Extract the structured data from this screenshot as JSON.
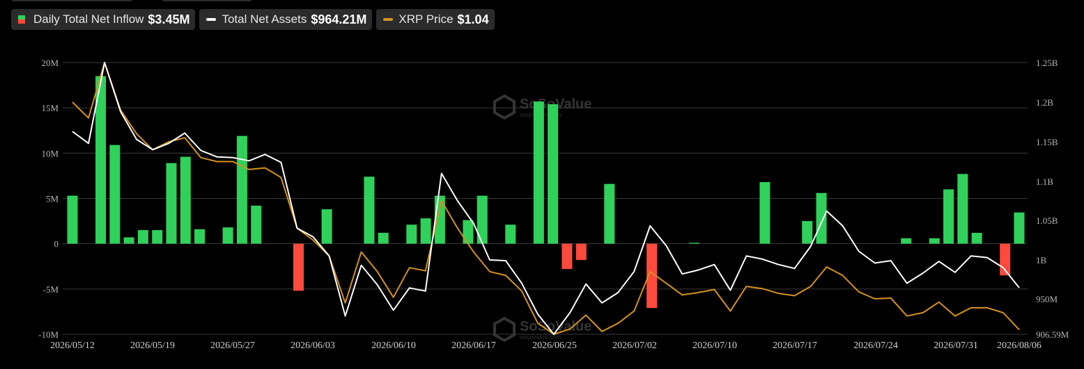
{
  "legend": [
    {
      "label": "Daily Total Net Inflow",
      "value": "$3.45M",
      "swatch": "split",
      "colors": [
        "#2fd15a",
        "#ff4a3d"
      ]
    },
    {
      "label": "Total Net Assets",
      "value": "$964.21M",
      "swatch": "line",
      "color": "#ffffff"
    },
    {
      "label": "XRP Price",
      "value": "$1.04",
      "swatch": "line",
      "color": "#d4921e"
    }
  ],
  "watermark": {
    "brand": "SoSoValue",
    "url": "sosovalue.com"
  },
  "chart_data": {
    "type": "bar",
    "x_ticks": [
      "2026/05/12",
      "2026/05/19",
      "2026/05/27",
      "2026/06/03",
      "2026/06/10",
      "2026/06/17",
      "2026/06/25",
      "2026/07/02",
      "2026/07/10",
      "2026/07/17",
      "2026/07/24",
      "2026/07/31",
      "2026/08/06"
    ],
    "y_left": {
      "ticks": [
        "20M",
        "15M",
        "10M",
        "5M",
        "0",
        "-5M",
        "-10M"
      ],
      "range": [
        -10000000,
        20000000
      ]
    },
    "y_right": {
      "ticks": [
        "1.25B",
        "1.2B",
        "1.15B",
        "1.1B",
        "1.05B",
        "1B",
        "950M",
        "906.59M"
      ],
      "range": [
        906590000,
        1250000000
      ]
    },
    "colors": {
      "positive": "#2fd15a",
      "negative": "#ff4a3d",
      "assets": "#ffffff",
      "price": "#d4921e",
      "grid": "#3a3a3a"
    },
    "series": [
      {
        "name": "Daily Total Net Inflow",
        "kind": "bar",
        "values": [
          5.3,
          null,
          18.5,
          10.9,
          0.7,
          1.5,
          1.5,
          8.9,
          9.6,
          1.6,
          null,
          1.8,
          11.9,
          4.2,
          null,
          null,
          -5.2,
          null,
          3.8,
          null,
          null,
          7.4,
          1.2,
          null,
          2.1,
          2.8,
          5.3,
          null,
          2.6,
          5.3,
          null,
          2.1,
          null,
          15.7,
          15.4,
          -2.8,
          -1.8,
          null,
          6.6,
          null,
          null,
          -7.1,
          null,
          null,
          0.1,
          null,
          null,
          null,
          null,
          6.8,
          null,
          null,
          2.5,
          5.6,
          null,
          null,
          null,
          null,
          null,
          0.6,
          null,
          0.6,
          6.0,
          7.7,
          1.2,
          null,
          -3.5,
          3.45
        ]
      },
      {
        "name": "Total Net Assets",
        "kind": "line",
        "axis": "right",
        "values": [
          1163,
          1148,
          1250,
          1188,
          1153,
          1140,
          1148,
          1161,
          1139,
          1131,
          1130,
          1126,
          1134,
          1124,
          1040,
          1029,
          1005,
          929,
          993,
          968,
          936,
          964,
          960,
          1110,
          1075,
          1046,
          1000,
          999,
          970,
          931,
          906.59,
          933,
          969,
          945,
          958,
          985,
          1043,
          1018,
          982,
          987,
          994,
          961,
          1005,
          1001,
          994,
          989,
          1017,
          1062,
          1043,
          1011,
          996,
          999,
          970,
          983,
          998,
          984,
          1005,
          1003,
          990,
          964.21
        ]
      },
      {
        "name": "XRP Price",
        "kind": "line",
        "axis": "right",
        "values": [
          1.2,
          1.18,
          1.25,
          1.19,
          1.16,
          1.14,
          1.15,
          1.155,
          1.13,
          1.125,
          1.125,
          1.115,
          1.117,
          1.105,
          1.04,
          1.025,
          1.005,
          0.945,
          1.01,
          0.985,
          0.952,
          0.99,
          0.986,
          1.075,
          1.04,
          1.01,
          0.985,
          0.98,
          0.96,
          0.92,
          0.905,
          0.913,
          0.93,
          0.91,
          0.92,
          0.935,
          0.985,
          0.97,
          0.955,
          0.958,
          0.962,
          0.935,
          0.966,
          0.963,
          0.957,
          0.954,
          0.966,
          0.991,
          0.98,
          0.959,
          0.95,
          0.951,
          0.929,
          0.933,
          0.946,
          0.929,
          0.939,
          0.939,
          0.933,
          0.912
        ]
      }
    ]
  }
}
